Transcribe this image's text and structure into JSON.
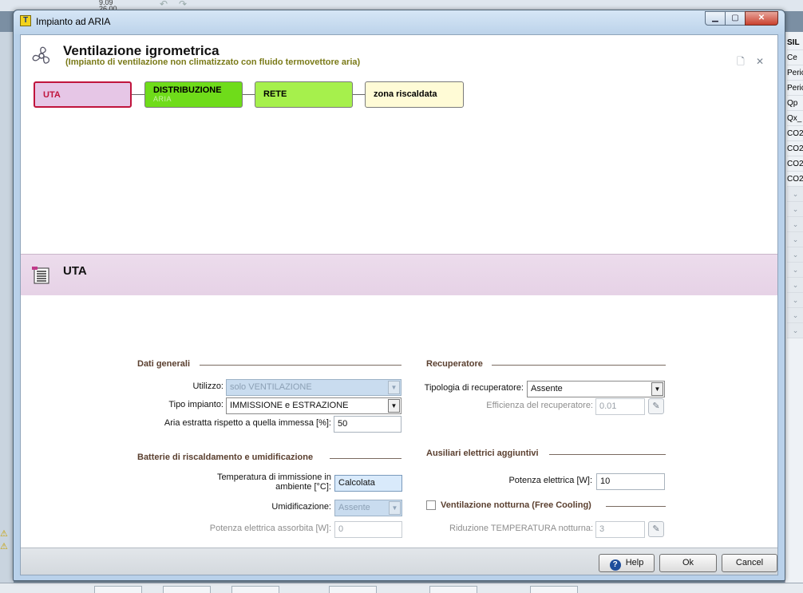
{
  "window": {
    "title": "Impianto ad ARIA",
    "app_icon": "T",
    "min_glyph": "▁",
    "max_glyph": "▢",
    "close_glyph": "✕"
  },
  "header": {
    "title": "Ventilazione igrometrica",
    "subtitle": "(Impianto di ventilazione non climatizzato con fluido termovettore aria)",
    "tools": [
      "new-document-icon",
      "close-document-icon"
    ]
  },
  "flow": {
    "nodes": [
      {
        "label": "UTA",
        "sub": "",
        "bg": "#e6c6e6",
        "border": "#c0143c",
        "color": "#c0143c"
      },
      {
        "label": "DISTRIBUZIONE",
        "sub": "ARIA",
        "bg": "#6fdc1a",
        "border": "#7a7a7a",
        "color": "#000000"
      },
      {
        "label": "RETE",
        "sub": "",
        "bg": "#a6f04c",
        "border": "#7a7a7a",
        "color": "#000000"
      },
      {
        "label": "zona riscaldata",
        "sub": "",
        "bg": "#fffbd6",
        "border": "#7a7a7a",
        "color": "#000000"
      }
    ]
  },
  "section": {
    "title": "UTA"
  },
  "form": {
    "dati_generali": {
      "title": "Dati generali",
      "utilizzo_label": "Utilizzo:",
      "utilizzo_value": "solo VENTILAZIONE",
      "tipo_label": "Tipo impianto:",
      "tipo_value": "IMMISSIONE e ESTRAZIONE",
      "aria_label": "Aria estratta rispetto a quella immessa [%]:",
      "aria_value": "50"
    },
    "batterie": {
      "title": "Batterie di riscaldamento e umidificazione",
      "temp_label_1": "Temperatura di immissione in",
      "temp_label_2": "ambiente [°C]:",
      "temp_value": "Calcolata",
      "umid_label": "Umidificazione:",
      "umid_value": "Assente",
      "potenza_label": "Potenza elettrica assorbita [W]:",
      "potenza_value": "0"
    },
    "recuperatore": {
      "title": "Recuperatore",
      "tipologia_label": "Tipologia di recuperatore:",
      "tipologia_value": "Assente",
      "efficienza_label": "Efficienza del recuperatore:",
      "efficienza_value": "0.01"
    },
    "ausiliari": {
      "title": "Ausiliari elettrici aggiuntivi",
      "potenza_label": "Potenza elettrica [W]:",
      "potenza_value": "10"
    },
    "ventilazione_notturna": {
      "title": "Ventilazione notturna (Free Cooling)",
      "checked": false,
      "riduzione_label": "Riduzione TEMPERATURA notturna:",
      "riduzione_value": "3"
    }
  },
  "footer": {
    "help_label": "Help",
    "ok_label": "Ok",
    "cancel_label": "Cancel"
  },
  "background": {
    "top_values": [
      "9.09",
      "26.00"
    ],
    "right_column": [
      "SIL",
      "Ce",
      "Peric",
      "Peric",
      "Qp",
      "Qx_",
      "CO2",
      "CO2",
      "CO2",
      "CO2"
    ],
    "left_warnings": [
      "W",
      "W"
    ]
  }
}
